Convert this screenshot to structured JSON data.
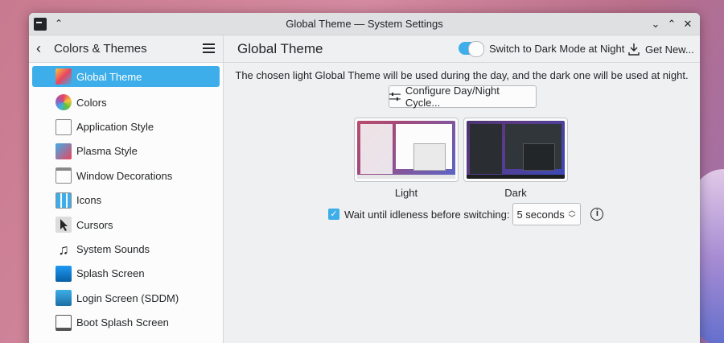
{
  "window": {
    "title": "Global Theme — System Settings"
  },
  "sidebar": {
    "title": "Colors & Themes",
    "items": [
      {
        "label": "Global Theme",
        "icon": "global-theme-icon"
      },
      {
        "label": "Colors",
        "icon": "colors-icon"
      },
      {
        "label": "Application Style",
        "icon": "application-style-icon"
      },
      {
        "label": "Plasma Style",
        "icon": "plasma-style-icon"
      },
      {
        "label": "Window Decorations",
        "icon": "window-decorations-icon"
      },
      {
        "label": "Icons",
        "icon": "icons-icon"
      },
      {
        "label": "Cursors",
        "icon": "cursors-icon"
      },
      {
        "label": "System Sounds",
        "icon": "system-sounds-icon"
      },
      {
        "label": "Splash Screen",
        "icon": "splash-screen-icon"
      },
      {
        "label": "Login Screen (SDDM)",
        "icon": "login-screen-icon"
      },
      {
        "label": "Boot Splash Screen",
        "icon": "boot-splash-icon"
      }
    ]
  },
  "header": {
    "title": "Global Theme",
    "dark_mode_label": "Switch to Dark Mode at Night",
    "dark_mode_enabled": true,
    "get_new_label": "Get New..."
  },
  "main": {
    "description": "The chosen light Global Theme will be used during the day, and the dark one will be used at night.",
    "configure_label": "Configure Day/Night Cycle...",
    "light_label": "Light",
    "dark_label": "Dark",
    "idle_label": "Wait until idleness before switching:",
    "idle_checked": true,
    "idle_value": "5 seconds"
  },
  "colors": {
    "accent": "#3daee9",
    "background": "#eff0f1"
  }
}
